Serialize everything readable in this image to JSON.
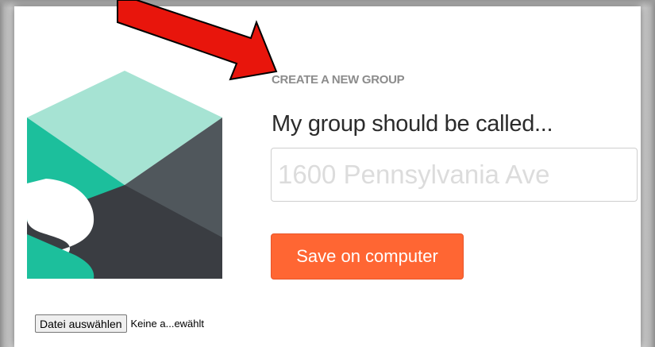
{
  "form": {
    "heading": "CREATE A NEW GROUP",
    "group_label": "My group should be called...",
    "group_input_value": "",
    "group_input_placeholder": "1600 Pennsylvania Ave",
    "save_button_label": "Save on computer"
  },
  "file_picker": {
    "button_label": "Datei auswählen",
    "status_text": "Keine a...ewählt"
  },
  "logo": {
    "letter": "s",
    "colors": {
      "teal_light": "#a6e3d3",
      "teal": "#1cbf9c",
      "dark": "#3a3d42",
      "gray": "#50575c"
    }
  },
  "annotation": {
    "arrow_color": "#e8150c",
    "arrow_outline": "#000000"
  },
  "colors": {
    "accent": "#ff6633",
    "heading": "#8c8c8c"
  }
}
